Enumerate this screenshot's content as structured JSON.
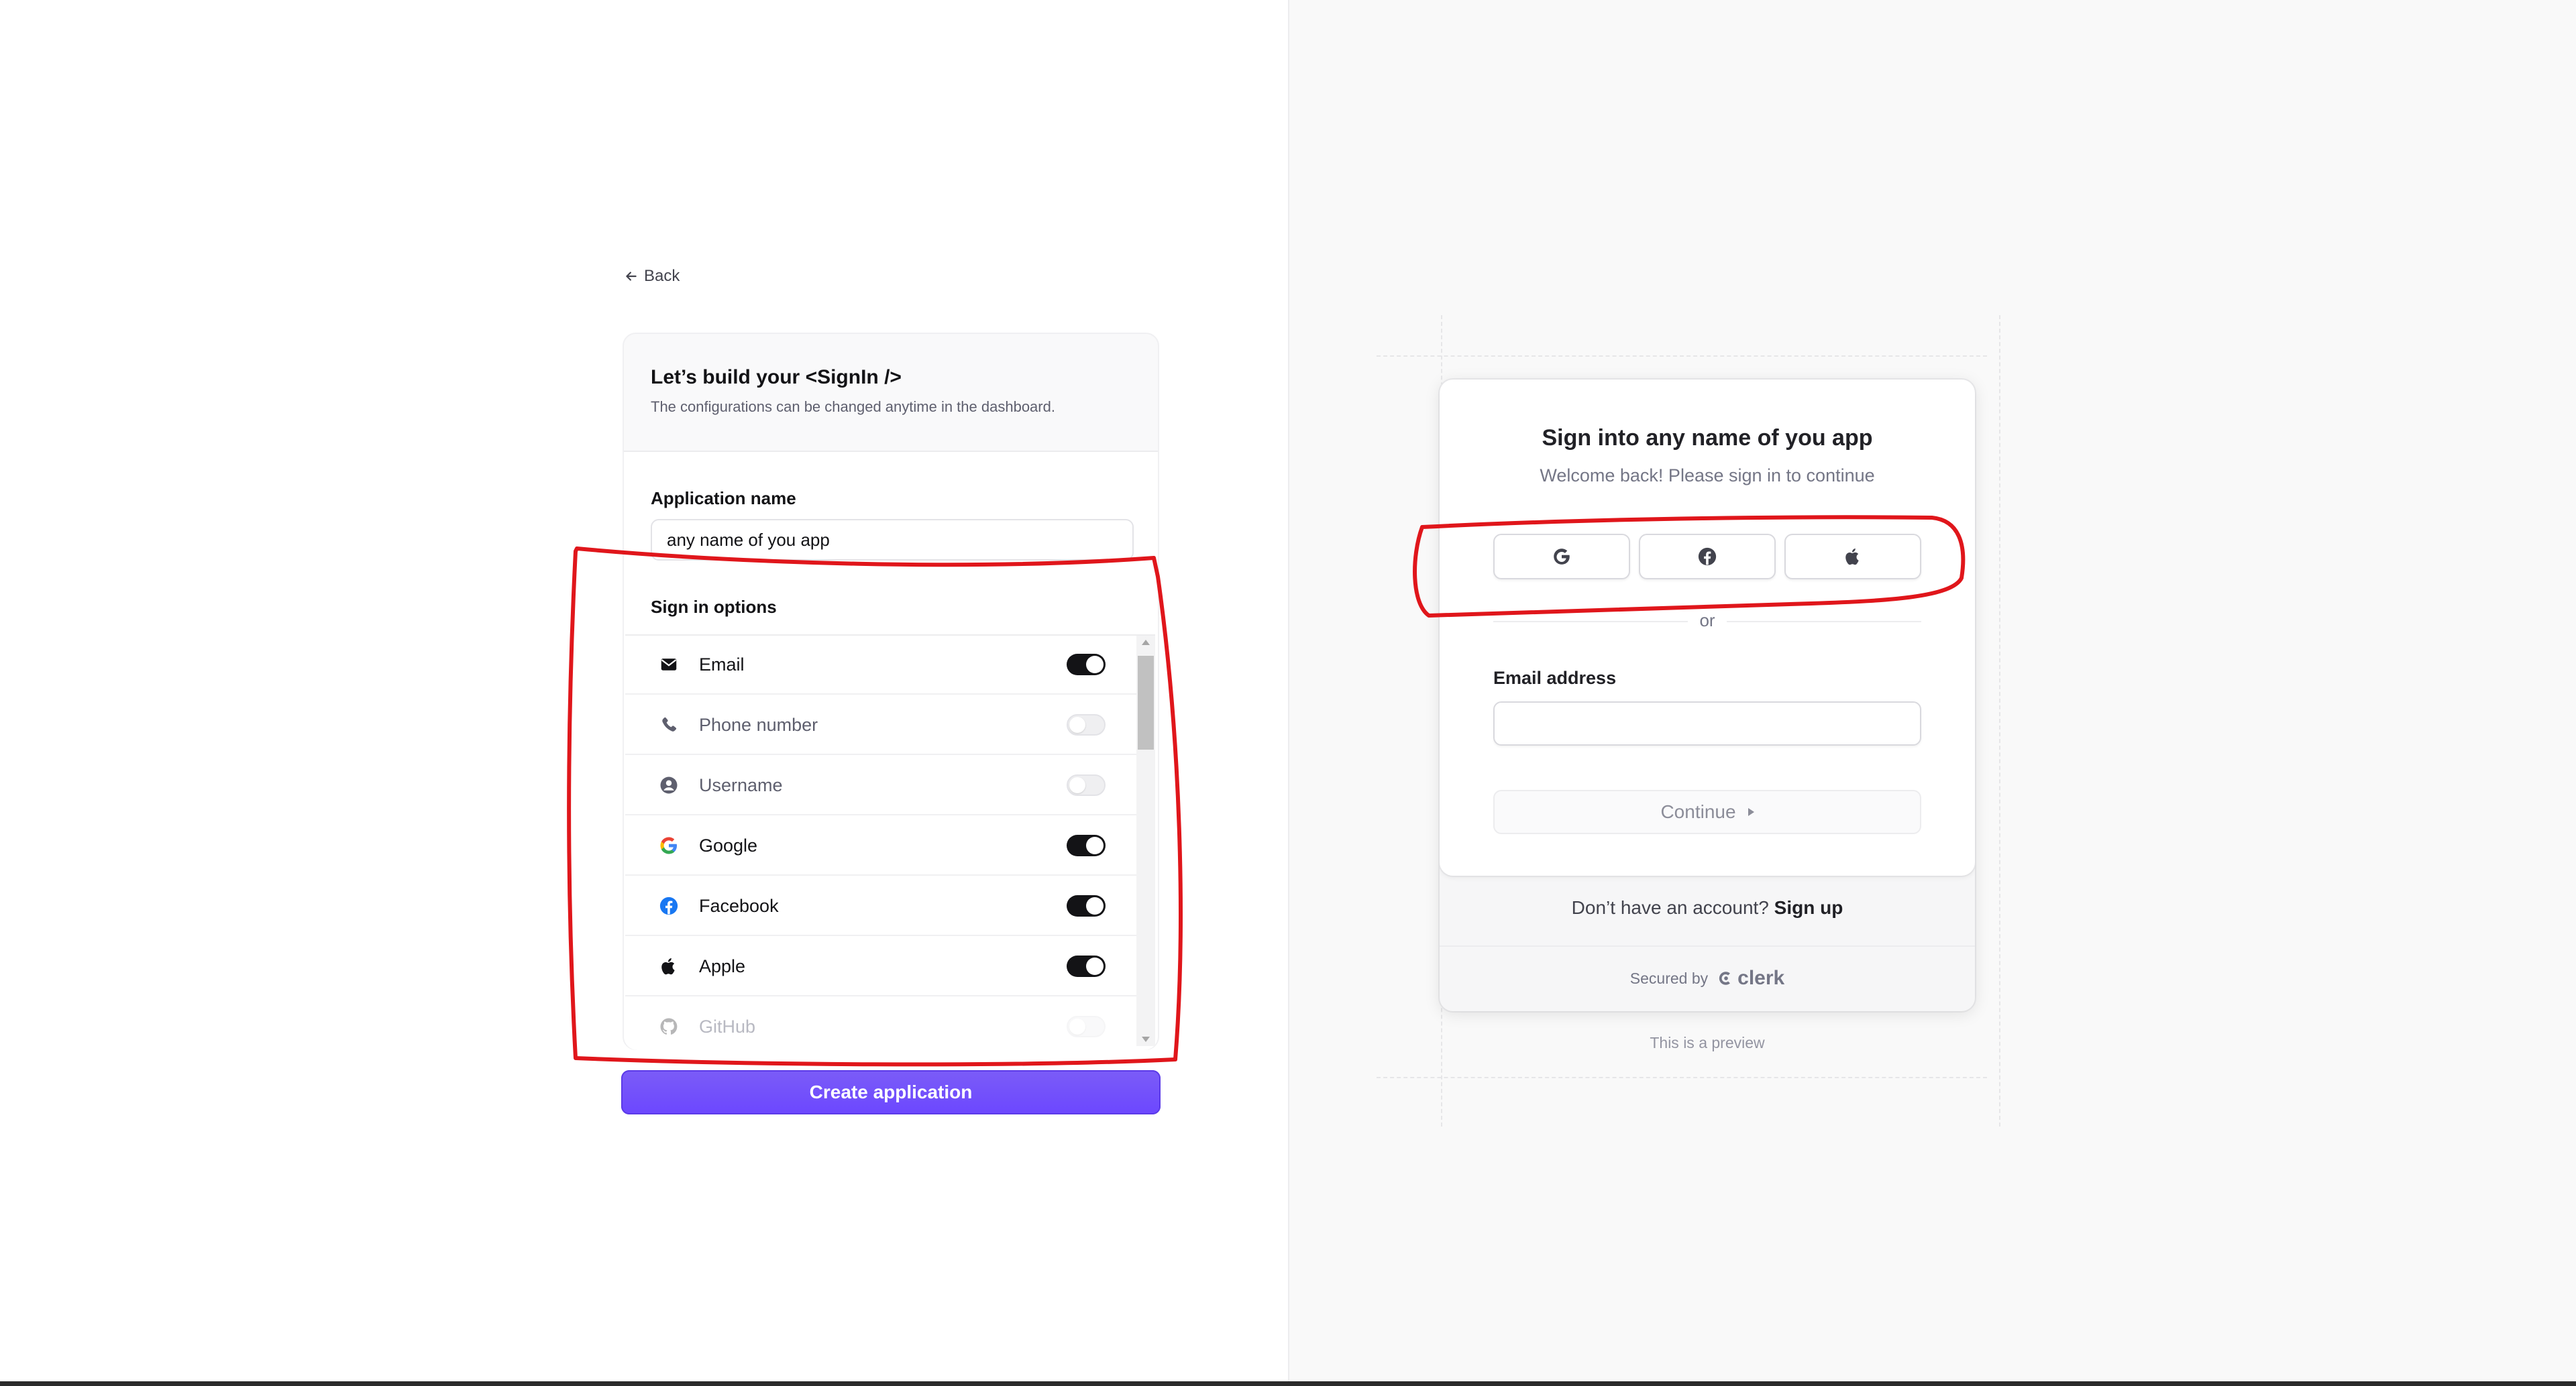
{
  "back": {
    "label": "Back"
  },
  "config": {
    "title": "Let’s build your <SignIn />",
    "subtitle": "The configurations can be changed anytime in the dashboard.",
    "app_name_label": "Application name",
    "app_name_value": "any name of you app",
    "sign_in_options_label": "Sign in options",
    "options": [
      {
        "label": "Email",
        "icon": "envelope-icon",
        "enabled": true
      },
      {
        "label": "Phone number",
        "icon": "phone-icon",
        "enabled": false
      },
      {
        "label": "Username",
        "icon": "user-circle-icon",
        "enabled": false
      },
      {
        "label": "Google",
        "icon": "google-icon",
        "enabled": true
      },
      {
        "label": "Facebook",
        "icon": "facebook-icon",
        "enabled": true
      },
      {
        "label": "Apple",
        "icon": "apple-icon",
        "enabled": true
      },
      {
        "label": "GitHub",
        "icon": "github-icon",
        "enabled": false
      }
    ],
    "create_button": "Create application"
  },
  "preview": {
    "title": "Sign into any name of you app",
    "subtitle": "Welcome back! Please sign in to continue",
    "social_buttons": [
      "google-icon",
      "facebook-icon",
      "apple-icon"
    ],
    "or_text": "or",
    "email_label": "Email address",
    "email_value": "",
    "continue_label": "Continue",
    "no_account_text": "Don’t have an account?",
    "sign_up_link": "Sign up",
    "secured_by": "Secured by",
    "clerk_brand": "clerk",
    "preview_note": "This is a preview"
  },
  "colors": {
    "accent": "#6c47ff",
    "toggle_on": "#131316",
    "annotation": "#e0161b"
  }
}
